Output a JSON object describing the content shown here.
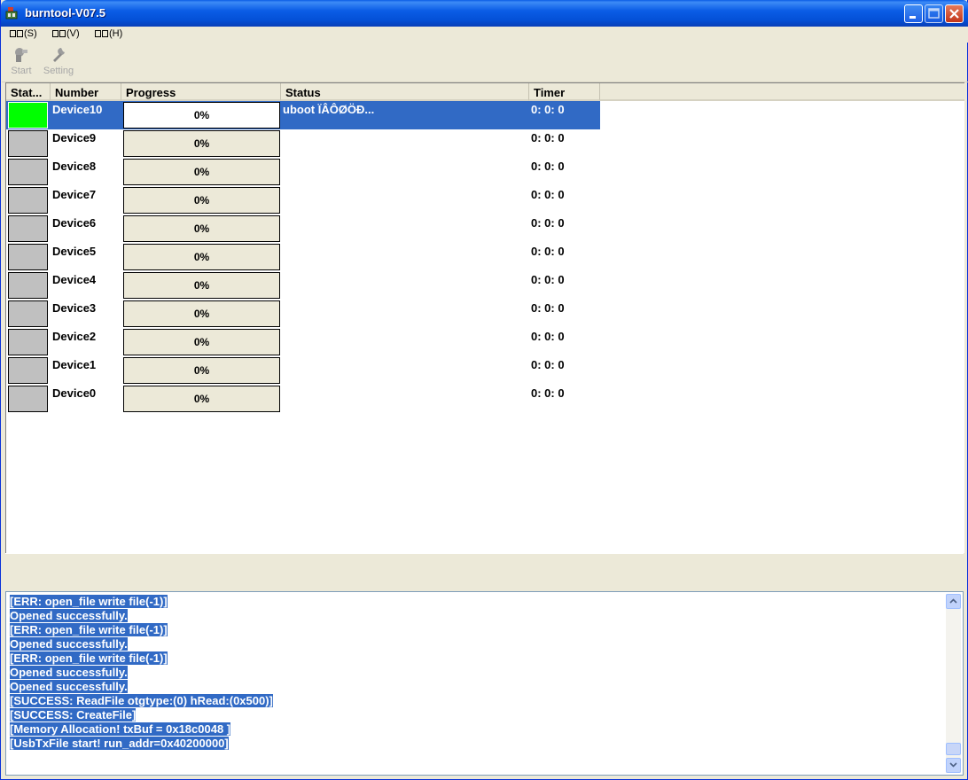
{
  "window": {
    "title": "burntool-V07.5"
  },
  "menu": [
    {
      "label": "(S)"
    },
    {
      "label": "(V)"
    },
    {
      "label": "(H)"
    }
  ],
  "toolbar": {
    "start_label": "Start",
    "setting_label": "Setting"
  },
  "columns": {
    "state": "Stat...",
    "number": "Number",
    "progress": "Progress",
    "status": "Status",
    "timer": "Timer"
  },
  "devices": [
    {
      "number": "Device10",
      "progress": "0%",
      "status": "uboot ÏÂÔØÖÐ...",
      "timer": "0: 0: 0",
      "selected": true,
      "state_color": "#00ff00"
    },
    {
      "number": "Device9",
      "progress": "0%",
      "status": "",
      "timer": "0: 0: 0"
    },
    {
      "number": "Device8",
      "progress": "0%",
      "status": "",
      "timer": "0: 0: 0"
    },
    {
      "number": "Device7",
      "progress": "0%",
      "status": "",
      "timer": "0: 0: 0"
    },
    {
      "number": "Device6",
      "progress": "0%",
      "status": "",
      "timer": "0: 0: 0"
    },
    {
      "number": "Device5",
      "progress": "0%",
      "status": "",
      "timer": "0: 0: 0"
    },
    {
      "number": "Device4",
      "progress": "0%",
      "status": "",
      "timer": "0: 0: 0"
    },
    {
      "number": "Device3",
      "progress": "0%",
      "status": "",
      "timer": "0: 0: 0"
    },
    {
      "number": "Device2",
      "progress": "0%",
      "status": "",
      "timer": "0: 0: 0"
    },
    {
      "number": "Device1",
      "progress": "0%",
      "status": "",
      "timer": "0: 0: 0"
    },
    {
      "number": "Device0",
      "progress": "0%",
      "status": "",
      "timer": "0: 0: 0"
    }
  ],
  "log": [
    "[ERR: open_file write file(-1)]",
    "Opened successfully.",
    "[ERR: open_file write file(-1)]",
    "Opened successfully.",
    "[ERR: open_file write file(-1)]",
    "Opened successfully.",
    "Opened successfully.",
    "[SUCCESS: ReadFile otgtype:(0) hRead:(0x500)]",
    "[SUCCESS: CreateFile]",
    "[Memory Allocation! txBuf = 0x18c0048 ]",
    "[UsbTxFile start! run_addr=0x40200000]"
  ],
  "icons": {
    "app": "burntool-app-icon",
    "start": "start-icon",
    "setting": "wrench-icon"
  }
}
